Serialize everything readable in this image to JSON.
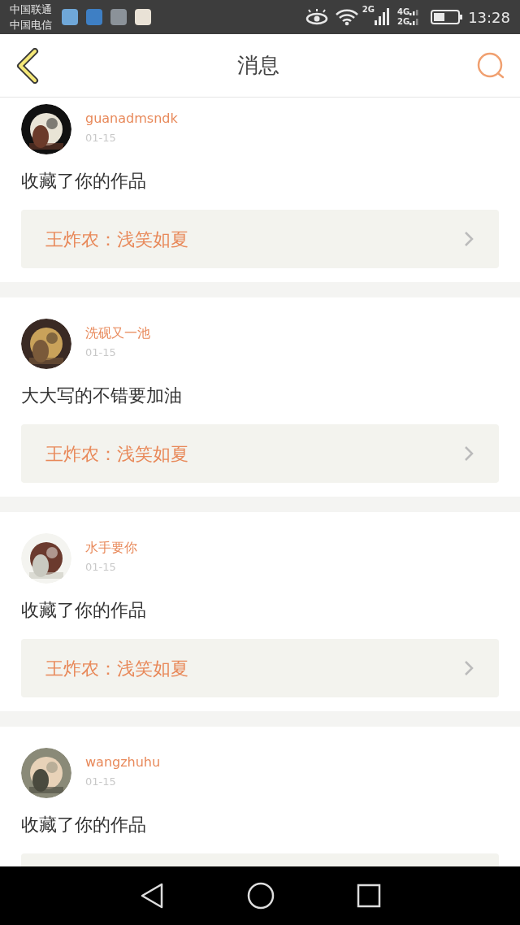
{
  "status_bar": {
    "carriers": [
      "中国联通",
      "中国电信"
    ],
    "signal_labels": [
      "2G",
      "4G",
      "2G"
    ],
    "time": "13:28"
  },
  "header": {
    "title": "消息"
  },
  "messages": [
    {
      "user": "guanadmsndk",
      "date": "01-15",
      "text": "收藏了你的作品",
      "quote": "王炸农：浅笑如夏"
    },
    {
      "user": "洗砚又一池",
      "date": "01-15",
      "text": "大大写的不错要加油",
      "quote": "王炸农：浅笑如夏"
    },
    {
      "user": "水手要你",
      "date": "01-15",
      "text": "收藏了你的作品",
      "quote": "王炸农：浅笑如夏"
    },
    {
      "user": "wangzhuhu",
      "date": "01-15",
      "text": "收藏了你的作品"
    }
  ]
}
